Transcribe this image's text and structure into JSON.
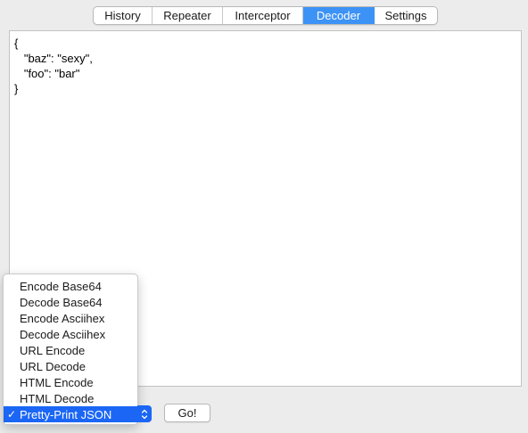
{
  "tabs": [
    {
      "label": "History",
      "active": false
    },
    {
      "label": "Repeater",
      "active": false
    },
    {
      "label": "Interceptor",
      "active": false
    },
    {
      "label": "Decoder",
      "active": true
    },
    {
      "label": "Settings",
      "active": false
    }
  ],
  "editor": {
    "content": "{\n   \"baz\": \"sexy\",\n   \"foo\": \"bar\"\n}"
  },
  "decoder_menu": {
    "items": [
      "Encode Base64",
      "Decode Base64",
      "Encode Asciihex",
      "Decode Asciihex",
      "URL Encode",
      "URL Decode",
      "HTML Encode",
      "HTML Decode",
      "Pretty-Print JSON"
    ],
    "selected": "Pretty-Print JSON",
    "check_glyph": "✓"
  },
  "go_button": {
    "label": "Go!"
  },
  "colors": {
    "accent": "#3d92f5",
    "selection": "#1b66f5",
    "background": "#ececec"
  }
}
